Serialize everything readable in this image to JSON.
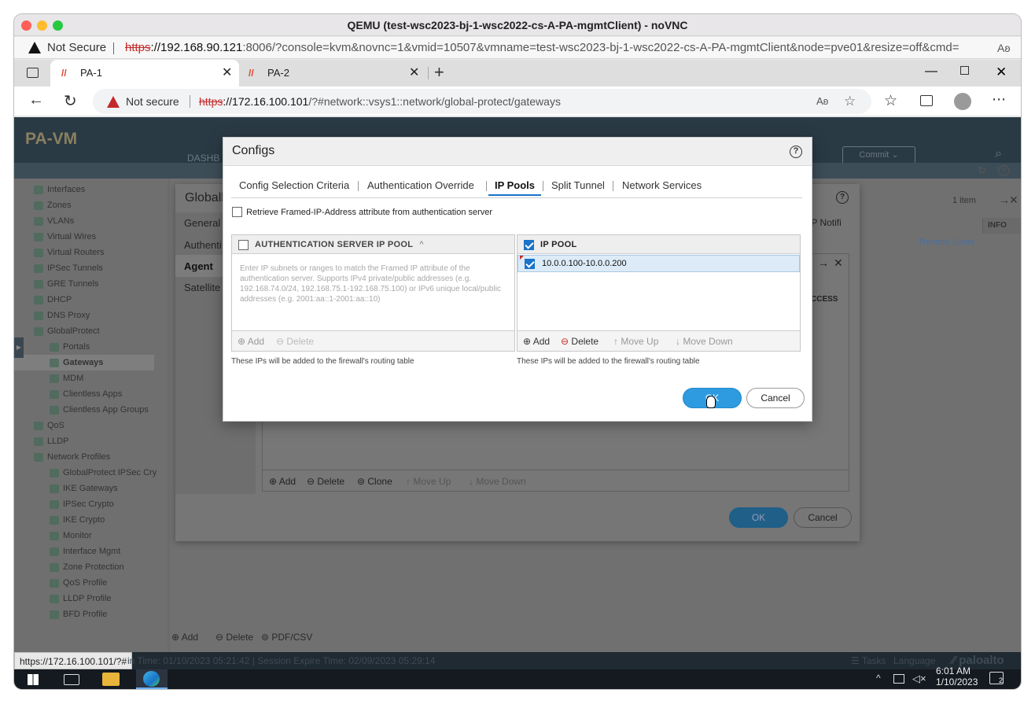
{
  "mac": {
    "title": "QEMU (test-wsc2023-bj-1-wsc2022-cs-A-PA-mgmtClient) - noVNC",
    "security_label": "Not Secure",
    "url_scheme": "https",
    "url_host": "://192.168.90.121",
    "url_rest": ":8006/?console=kvm&novnc=1&vmid=10507&vmname=test-wsc2023-bj-1-wsc2022-cs-A-PA-mgmtClient&node=pve01&resize=off&cmd="
  },
  "browser": {
    "tabs": [
      {
        "label": "PA-1"
      },
      {
        "label": "PA-2"
      }
    ],
    "security_label": "Not secure",
    "url_scheme": "https",
    "url_host": "://172.16.100.101",
    "url_rest": "/?#network::vsys1::network/global-protect/gateways"
  },
  "app": {
    "logo": "PA-VM",
    "top_tab": "DASHB",
    "commit_label": "Commit",
    "nav_items": [
      {
        "label": "Interfaces",
        "indent": 1
      },
      {
        "label": "Zones",
        "indent": 1
      },
      {
        "label": "VLANs",
        "indent": 1
      },
      {
        "label": "Virtual Wires",
        "indent": 1
      },
      {
        "label": "Virtual Routers",
        "indent": 1
      },
      {
        "label": "IPSec Tunnels",
        "indent": 1
      },
      {
        "label": "GRE Tunnels",
        "indent": 1
      },
      {
        "label": "DHCP",
        "indent": 1
      },
      {
        "label": "DNS Proxy",
        "indent": 1
      },
      {
        "label": "GlobalProtect",
        "indent": 1
      },
      {
        "label": "Portals",
        "indent": 2
      },
      {
        "label": "Gateways",
        "indent": 2
      },
      {
        "label": "MDM",
        "indent": 2
      },
      {
        "label": "Clientless Apps",
        "indent": 2
      },
      {
        "label": "Clientless App Groups",
        "indent": 2
      },
      {
        "label": "QoS",
        "indent": 1
      },
      {
        "label": "LLDP",
        "indent": 1
      },
      {
        "label": "Network Profiles",
        "indent": 1
      },
      {
        "label": "GlobalProtect IPSec Cry",
        "indent": 2
      },
      {
        "label": "IKE Gateways",
        "indent": 2
      },
      {
        "label": "IPSec Crypto",
        "indent": 2
      },
      {
        "label": "IKE Crypto",
        "indent": 2
      },
      {
        "label": "Monitor",
        "indent": 2
      },
      {
        "label": "Interface Mgmt",
        "indent": 2
      },
      {
        "label": "Zone Protection",
        "indent": 2
      },
      {
        "label": "QoS Profile",
        "indent": 2
      },
      {
        "label": "LLDP Profile",
        "indent": 2
      },
      {
        "label": "BFD Profile",
        "indent": 2
      }
    ],
    "items_count": "1 item",
    "col_ip_notif": "IP Notifi",
    "col_info": "INFO",
    "cell_info": "Remote Users",
    "gw_dialog": {
      "title": "Globall",
      "side_tabs": [
        "General",
        "Authenti",
        "Agent",
        "Satellite"
      ],
      "col_access": "CCESS",
      "footer": {
        "add": "Add",
        "delete": "Delete",
        "clone": "Clone",
        "move_up": "Move Up",
        "move_down": "Move Down"
      },
      "ok": "OK",
      "cancel": "Cancel"
    },
    "bottom_actions": {
      "add": "Add",
      "delete": "Delete",
      "pdf": "PDF/CSV"
    },
    "status_left": "https://172.16.100.101/?#",
    "status_text": "in Time: 01/10/2023 05:21:42  |  Session Expire Time: 02/09/2023 05:29:14",
    "status_tasks": "Tasks",
    "status_language": "Language",
    "brand": "paloalto"
  },
  "configs": {
    "title": "Configs",
    "tabs": [
      "Config Selection Criteria",
      "Authentication Override",
      "IP Pools",
      "Split Tunnel",
      "Network Services"
    ],
    "active_tab": "IP Pools",
    "retrieve_label": "Retrieve Framed-IP-Address attribute from authentication server",
    "auth_pool": {
      "header": "AUTHENTICATION SERVER IP POOL",
      "placeholder": "Enter IP subnets or ranges to match the Framed IP attribute of the authentication server. Supports IPv4 private/public addresses (e.g. 192.168.74.0/24, 192.168.75.1-192.168.75.100) or IPv6 unique local/public addresses (e.g. 2001:aa::1-2001:aa::10)",
      "add": "Add",
      "delete": "Delete",
      "note": "These IPs will be added to the firewall's routing table"
    },
    "ip_pool": {
      "header": "IP POOL",
      "rows": [
        "10.0.0.100-10.0.0.200"
      ],
      "add": "Add",
      "delete": "Delete",
      "move_up": "Move Up",
      "move_down": "Move Down",
      "note": "These IPs will be added to the firewall's routing table"
    },
    "ok": "OK",
    "cancel": "Cancel"
  },
  "taskbar": {
    "time": "6:01 AM",
    "date": "1/10/2023",
    "notif_count": "2"
  },
  "colors": {
    "accent": "#1a73c8",
    "ok_button": "#2e9be0",
    "pa_header": "#2a3a45",
    "tab_icon": "#e0422c"
  }
}
